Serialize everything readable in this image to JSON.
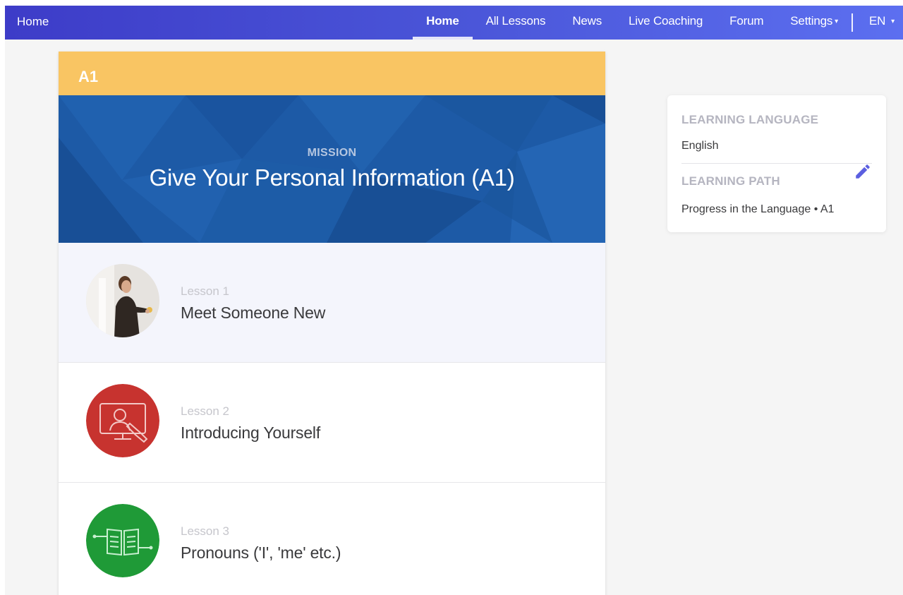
{
  "nav": {
    "brand": "Home",
    "items": [
      {
        "label": "Home",
        "active": true
      },
      {
        "label": "All Lessons"
      },
      {
        "label": "News"
      },
      {
        "label": "Live Coaching"
      },
      {
        "label": "Forum"
      },
      {
        "label": "Settings",
        "has_dropdown": true
      }
    ],
    "language": "EN"
  },
  "mission": {
    "level": "A1",
    "label": "MISSION",
    "title": "Give Your Personal Information (A1)",
    "lessons": [
      {
        "number": "Lesson 1",
        "title": "Meet Someone New",
        "thumb": "photo-woman-holding-cup",
        "current": true
      },
      {
        "number": "Lesson 2",
        "title": "Introducing Yourself",
        "thumb": "video-call-icon"
      },
      {
        "number": "Lesson 3",
        "title": "Pronouns ('I', 'me' etc.)",
        "thumb": "open-book-icon"
      }
    ]
  },
  "sidebar": {
    "learning_language_label": "LEARNING LANGUAGE",
    "learning_language": "English",
    "learning_path_label": "LEARNING PATH",
    "learning_path_name": "Progress in the Language",
    "learning_path_sep": "•",
    "learning_path_level": "A1",
    "edit_icon": "pencil-icon"
  },
  "colors": {
    "nav_start": "#3d3cc8",
    "nav_end": "#5c6ff0",
    "level_bar": "#f9c563",
    "hero": "#1d5aa6",
    "lesson2_circle": "#c7332f",
    "lesson3_circle": "#1f9a37",
    "edit_icon": "#5b5fe0"
  }
}
